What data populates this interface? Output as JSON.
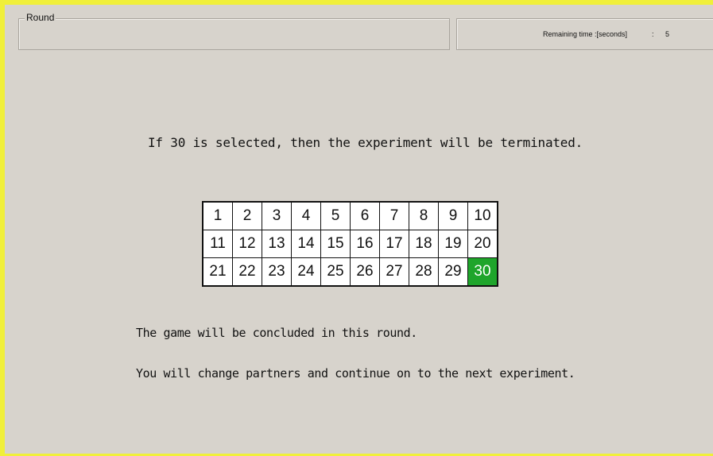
{
  "header": {
    "round_label": "Round",
    "remaining_time_label": "Remaining time :[seconds]",
    "separator": ":",
    "remaining_time_value": "5"
  },
  "main": {
    "selection_message": "If 30 is selected, then the experiment will be terminated.",
    "conclusion_message": "The game will be concluded in this round.",
    "partner_message": "You will change partners and continue on to the next experiment."
  },
  "grid": {
    "cells": [
      "1",
      "2",
      "3",
      "4",
      "5",
      "6",
      "7",
      "8",
      "9",
      "10",
      "11",
      "12",
      "13",
      "14",
      "15",
      "16",
      "17",
      "18",
      "19",
      "20",
      "21",
      "22",
      "23",
      "24",
      "25",
      "26",
      "27",
      "28",
      "29",
      "30"
    ],
    "selected": "30",
    "selected_color": "#1fa52b"
  },
  "colors": {
    "frame_border": "#f0ef3a",
    "background": "#d7d3cc"
  }
}
